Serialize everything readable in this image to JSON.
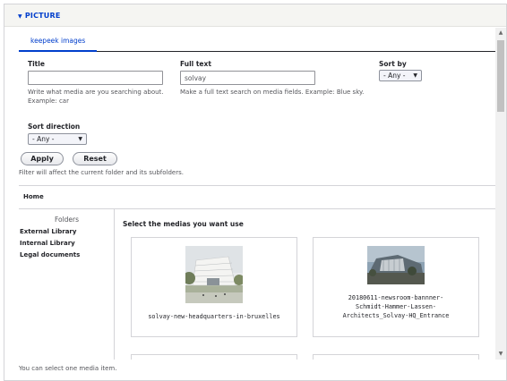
{
  "section": {
    "arrow": "▼",
    "title": "PICTURE"
  },
  "tabs": [
    {
      "label": "keepeek images"
    }
  ],
  "filters": {
    "title": {
      "label": "Title",
      "value": "",
      "description_line1": "Write what media are you searching about.",
      "description_line2": "Example: car"
    },
    "full_text": {
      "label": "Full text",
      "value": "solvay",
      "description": "Make a full text search on media fields. Example: Blue sky."
    },
    "sort_by": {
      "label": "Sort by",
      "selected": "- Any -"
    },
    "sort_direction": {
      "label": "Sort direction",
      "selected": "- Any -"
    },
    "apply_label": "Apply",
    "reset_label": "Reset",
    "note": "Filter will affect the current folder and its subfolders."
  },
  "breadcrumb": {
    "home": "Home"
  },
  "folders": {
    "heading": "Folders",
    "items": [
      "External Library",
      "Internal Library",
      "Legal documents"
    ]
  },
  "media": {
    "heading": "Select the medias you want use",
    "items": [
      {
        "caption_lines": [
          "solvay-new-headquarters-in-bruxelles"
        ]
      },
      {
        "caption_lines": [
          "20180611-newsroom-bannner-",
          "Schmidt-Hammer-Lassen-",
          "Architects_Solvay-HQ_Entrance"
        ]
      }
    ]
  },
  "footer": {
    "text": "You can select one media item."
  },
  "colors": {
    "accent": "#003ecc",
    "border": "#d4d4d8",
    "text": "#232429"
  },
  "icons": {
    "collapse": "triangle-down-icon",
    "select_caret": "caret-down-icon",
    "scroll_up": "scroll-up-icon",
    "scroll_down": "scroll-down-icon"
  }
}
